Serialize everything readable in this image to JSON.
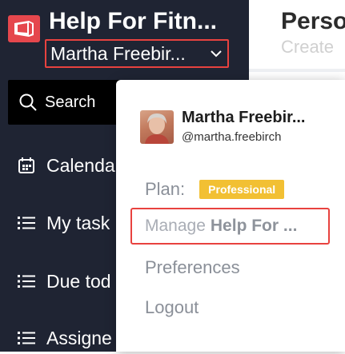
{
  "sidebar": {
    "app_title": "Help For Fitn...",
    "account_name": "Martha Freebir...",
    "search_label": "Search",
    "nav_items": [
      {
        "label": "Calenda",
        "icon": "calendar-icon"
      },
      {
        "label": "My task",
        "icon": "list-icon"
      },
      {
        "label": "Due tod",
        "icon": "list-icon"
      },
      {
        "label": "Assigne",
        "icon": "list-icon"
      }
    ]
  },
  "main": {
    "title": "Perso",
    "subtitle": "Create"
  },
  "dropdown": {
    "profile_name": "Martha Freebir...",
    "profile_handle": "@martha.freebirch",
    "plan_label": "Plan:",
    "plan_badge": "Professional",
    "manage_prefix": "Manage",
    "manage_bold": "Help For ...",
    "preferences": "Preferences",
    "logout": "Logout"
  },
  "colors": {
    "sidebar_bg": "#1f2433",
    "accent_red": "#e8423f",
    "badge_yellow": "#f2c033"
  }
}
